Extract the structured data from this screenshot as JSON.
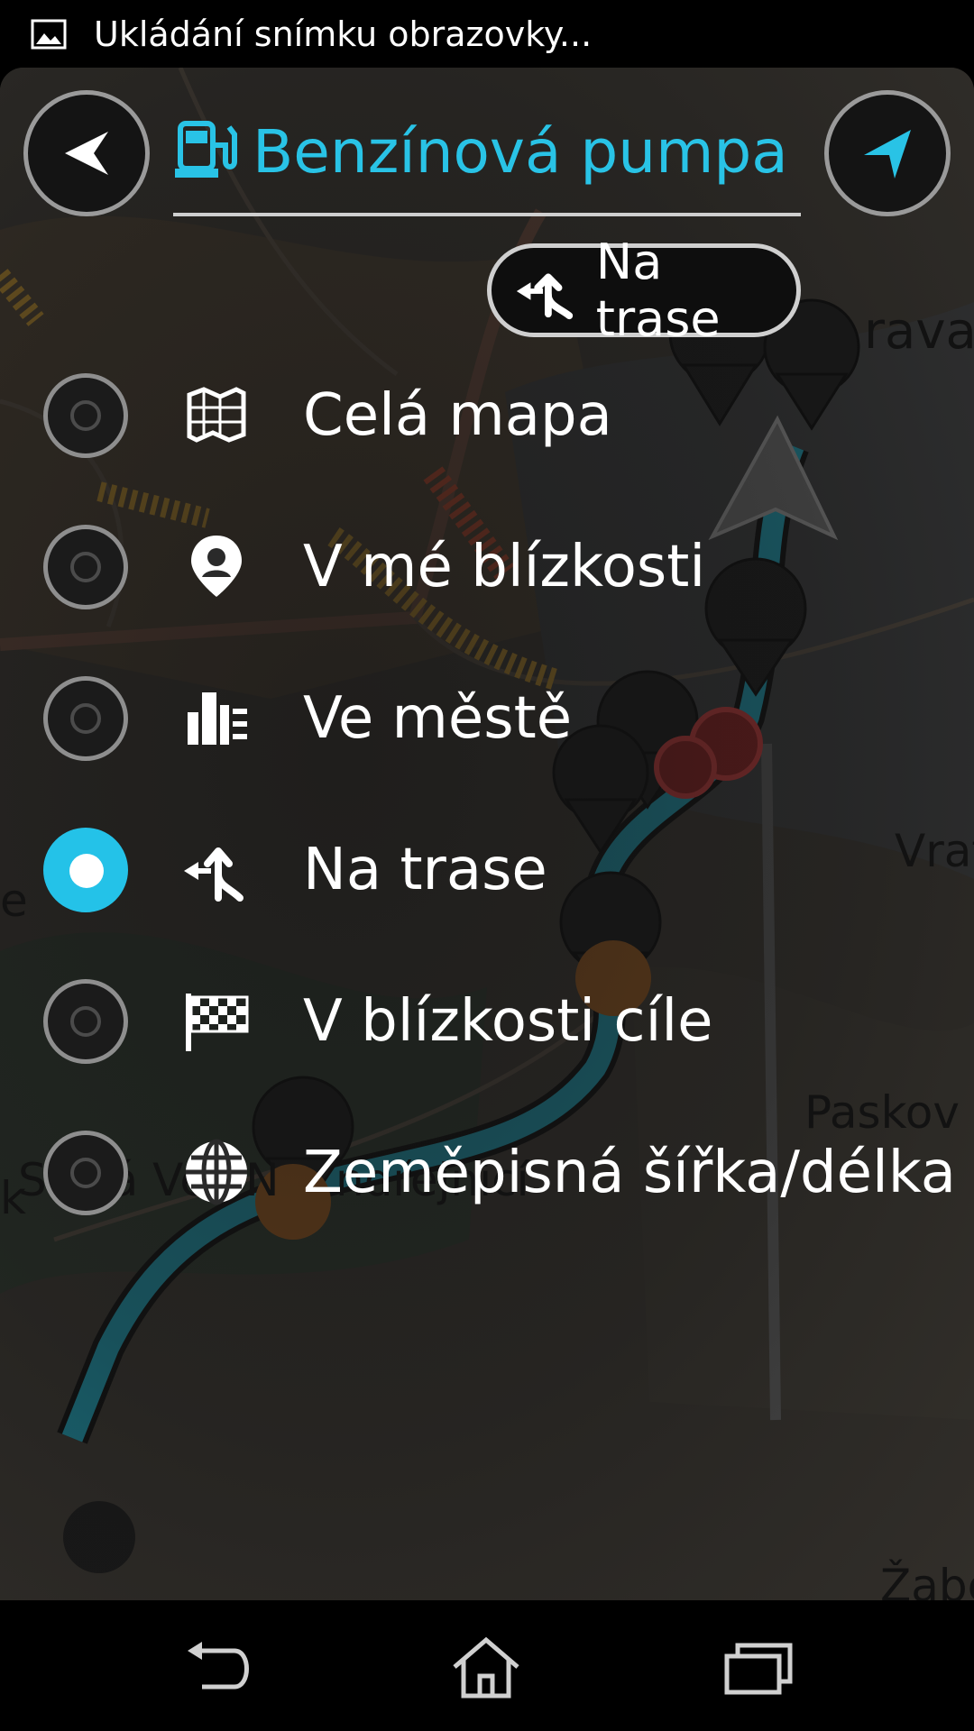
{
  "status_bar": {
    "notification_text": "Ukládání snímku obrazovky...",
    "icon": "image-icon"
  },
  "header": {
    "back_icon": "back-arrow-icon",
    "title": "Benzínová pumpa",
    "title_icon": "fuel-pump-icon",
    "nav_icon": "navigation-arrow-icon"
  },
  "current_filter": {
    "label": "Na trase",
    "icon": "along-route-icon"
  },
  "options": [
    {
      "label": "Celá mapa",
      "icon": "map-icon",
      "selected": false
    },
    {
      "label": "V mé blízkosti",
      "icon": "location-pin-icon",
      "selected": false
    },
    {
      "label": "Ve městě",
      "icon": "city-icon",
      "selected": false
    },
    {
      "label": "Na trase",
      "icon": "along-route-icon",
      "selected": true
    },
    {
      "label": "V blízkosti cíle",
      "icon": "finish-flag-icon",
      "selected": false
    },
    {
      "label": "Zeměpisná šířka/délka",
      "icon": "globe-icon",
      "selected": false
    }
  ],
  "map_labels": {
    "ostrava": "rava",
    "vratimov": "Vrat",
    "paskov": "Paskov",
    "stara_ves": "Stará Ves N",
    "ondrejnici": "ndřejnicí",
    "zabeh": "Žabe",
    "edge_e": "e",
    "edge_k": "k"
  },
  "colors": {
    "accent": "#29c3e6",
    "route": "#1d9ab0",
    "background": "#000000"
  },
  "navigation_bar": {
    "back": "nav-back-icon",
    "home": "nav-home-icon",
    "recents": "nav-recents-icon"
  }
}
